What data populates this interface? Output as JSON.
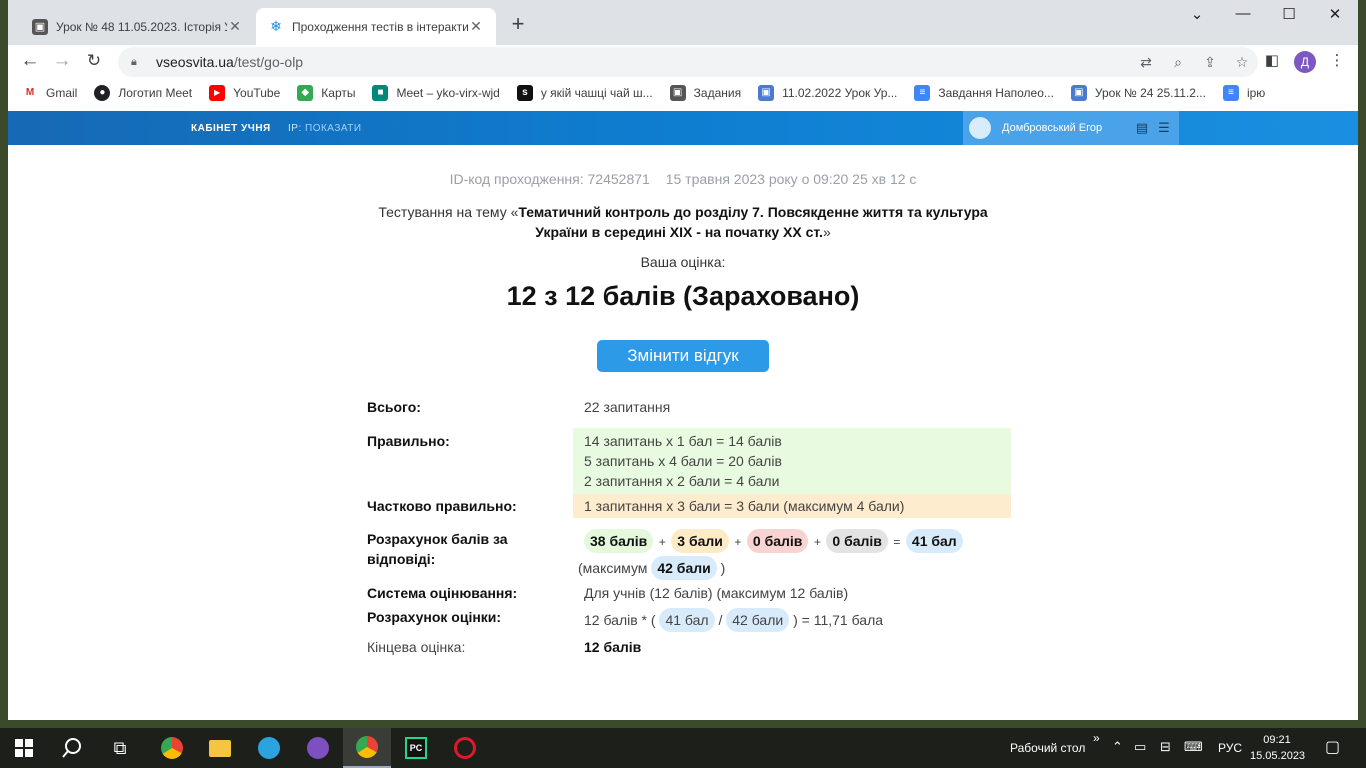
{
  "browser": {
    "tabs": [
      {
        "title": "Урок № 48 11.05.2023. Історія У",
        "close": "✕"
      },
      {
        "title": "Проходження тестів в інтеракти",
        "close": "✕"
      }
    ],
    "new_tab": "+",
    "window_controls": {
      "collapse": "⌄",
      "minimize": "—",
      "maximize": "☐",
      "close": "✕"
    },
    "url_host": "vseosvita.ua",
    "url_path": "/test/go-olp",
    "profile_initial": "Д",
    "bookmarks": [
      {
        "label": "Gmail",
        "icon": "gmail-icon",
        "glyph": "M",
        "color": "#d93025"
      },
      {
        "label": "Логотип Meet",
        "icon": "github-icon",
        "glyph": "●",
        "color": "#202124"
      },
      {
        "label": "YouTube",
        "icon": "youtube-icon",
        "glyph": "▶",
        "color": "#ff0000"
      },
      {
        "label": "Карты",
        "icon": "maps-icon",
        "glyph": "◆",
        "color": "#34a853"
      },
      {
        "label": "Meet – yko-virx-wjd",
        "icon": "meet-icon",
        "glyph": "■",
        "color": "#00897b"
      },
      {
        "label": "у якій чашці чай ш...",
        "icon": "bookmark-site-icon",
        "glyph": "s",
        "color": "#111111"
      },
      {
        "label": "Задания",
        "icon": "classroom-icon",
        "glyph": "▣",
        "color": "#555555"
      },
      {
        "label": "11.02.2022 Урок Ур...",
        "icon": "classroom-icon",
        "glyph": "▣",
        "color": "#4a7bd0"
      },
      {
        "label": "Завдання Наполео...",
        "icon": "docs-icon",
        "glyph": "≡",
        "color": "#4285f4"
      },
      {
        "label": "Урок № 24 25.11.2...",
        "icon": "classroom-icon",
        "glyph": "▣",
        "color": "#4a7bd0"
      },
      {
        "label": "ірю",
        "icon": "docs-icon",
        "glyph": "≡",
        "color": "#4285f4"
      }
    ]
  },
  "site": {
    "cabinet": "КАБІНЕТ УЧНЯ",
    "ip_label": "IP:",
    "ip_show": "ПОКАЗАТИ",
    "user_name": "Домбровський Егор"
  },
  "result": {
    "id_code": "ID-код проходження: 72452871",
    "datetime": "15 травня 2023 року о 09:20 25 хв 12 с",
    "topic_prefix": "Тестування на тему «",
    "topic_title": "Тематичний контроль до розділу 7. Повсякденне життя та культура України в середині ХІХ - на початку ХХ ст.",
    "topic_suffix": "»",
    "your_grade_label": "Ваша оцінка:",
    "grade": "12 з 12 балів (Зараховано)",
    "feedback_button": "Змінити відгук",
    "total_label": "Всього:",
    "total_value": "22 запитання",
    "correct_label": "Правильно:",
    "correct_lines": [
      "14 запитань x 1 бал = 14 балів",
      "5 запитань x 4 бали = 20 балів",
      "2 запитання x 2 бали = 4 бали"
    ],
    "partial_label": "Частково правильно:",
    "partial_value": "1 запитання x 3 бали = 3 бали (максимум 4 бали)",
    "calc_label": "Розрахунок балів за відповіді:",
    "calc_pills": [
      "38 балів",
      "3 бали",
      "0 балів",
      "0 балів",
      "41 бал"
    ],
    "calc_ops": [
      "+",
      "+",
      "+",
      "="
    ],
    "calc_max_prefix": "(максимум",
    "calc_max_value": "42 бали",
    "calc_max_suffix": ")",
    "system_label": "Система оцінювання:",
    "system_value": "Для учнів (12 балів) (максимум 12 балів)",
    "grade_calc_label": "Розрахунок оцінки:",
    "grade_calc_prefix": "12 балів * (",
    "grade_calc_a": "41 бал",
    "grade_calc_div": "/",
    "grade_calc_b": "42 бали",
    "grade_calc_suffix": ") = 11,71 бала",
    "final_label": "Кінцева оцінка:",
    "final_value": "12 балів"
  },
  "taskbar": {
    "desktop_label": "Рабочий стол",
    "chevron": "»",
    "lang": "РУС",
    "time": "09:21",
    "date": "15.05.2023"
  }
}
